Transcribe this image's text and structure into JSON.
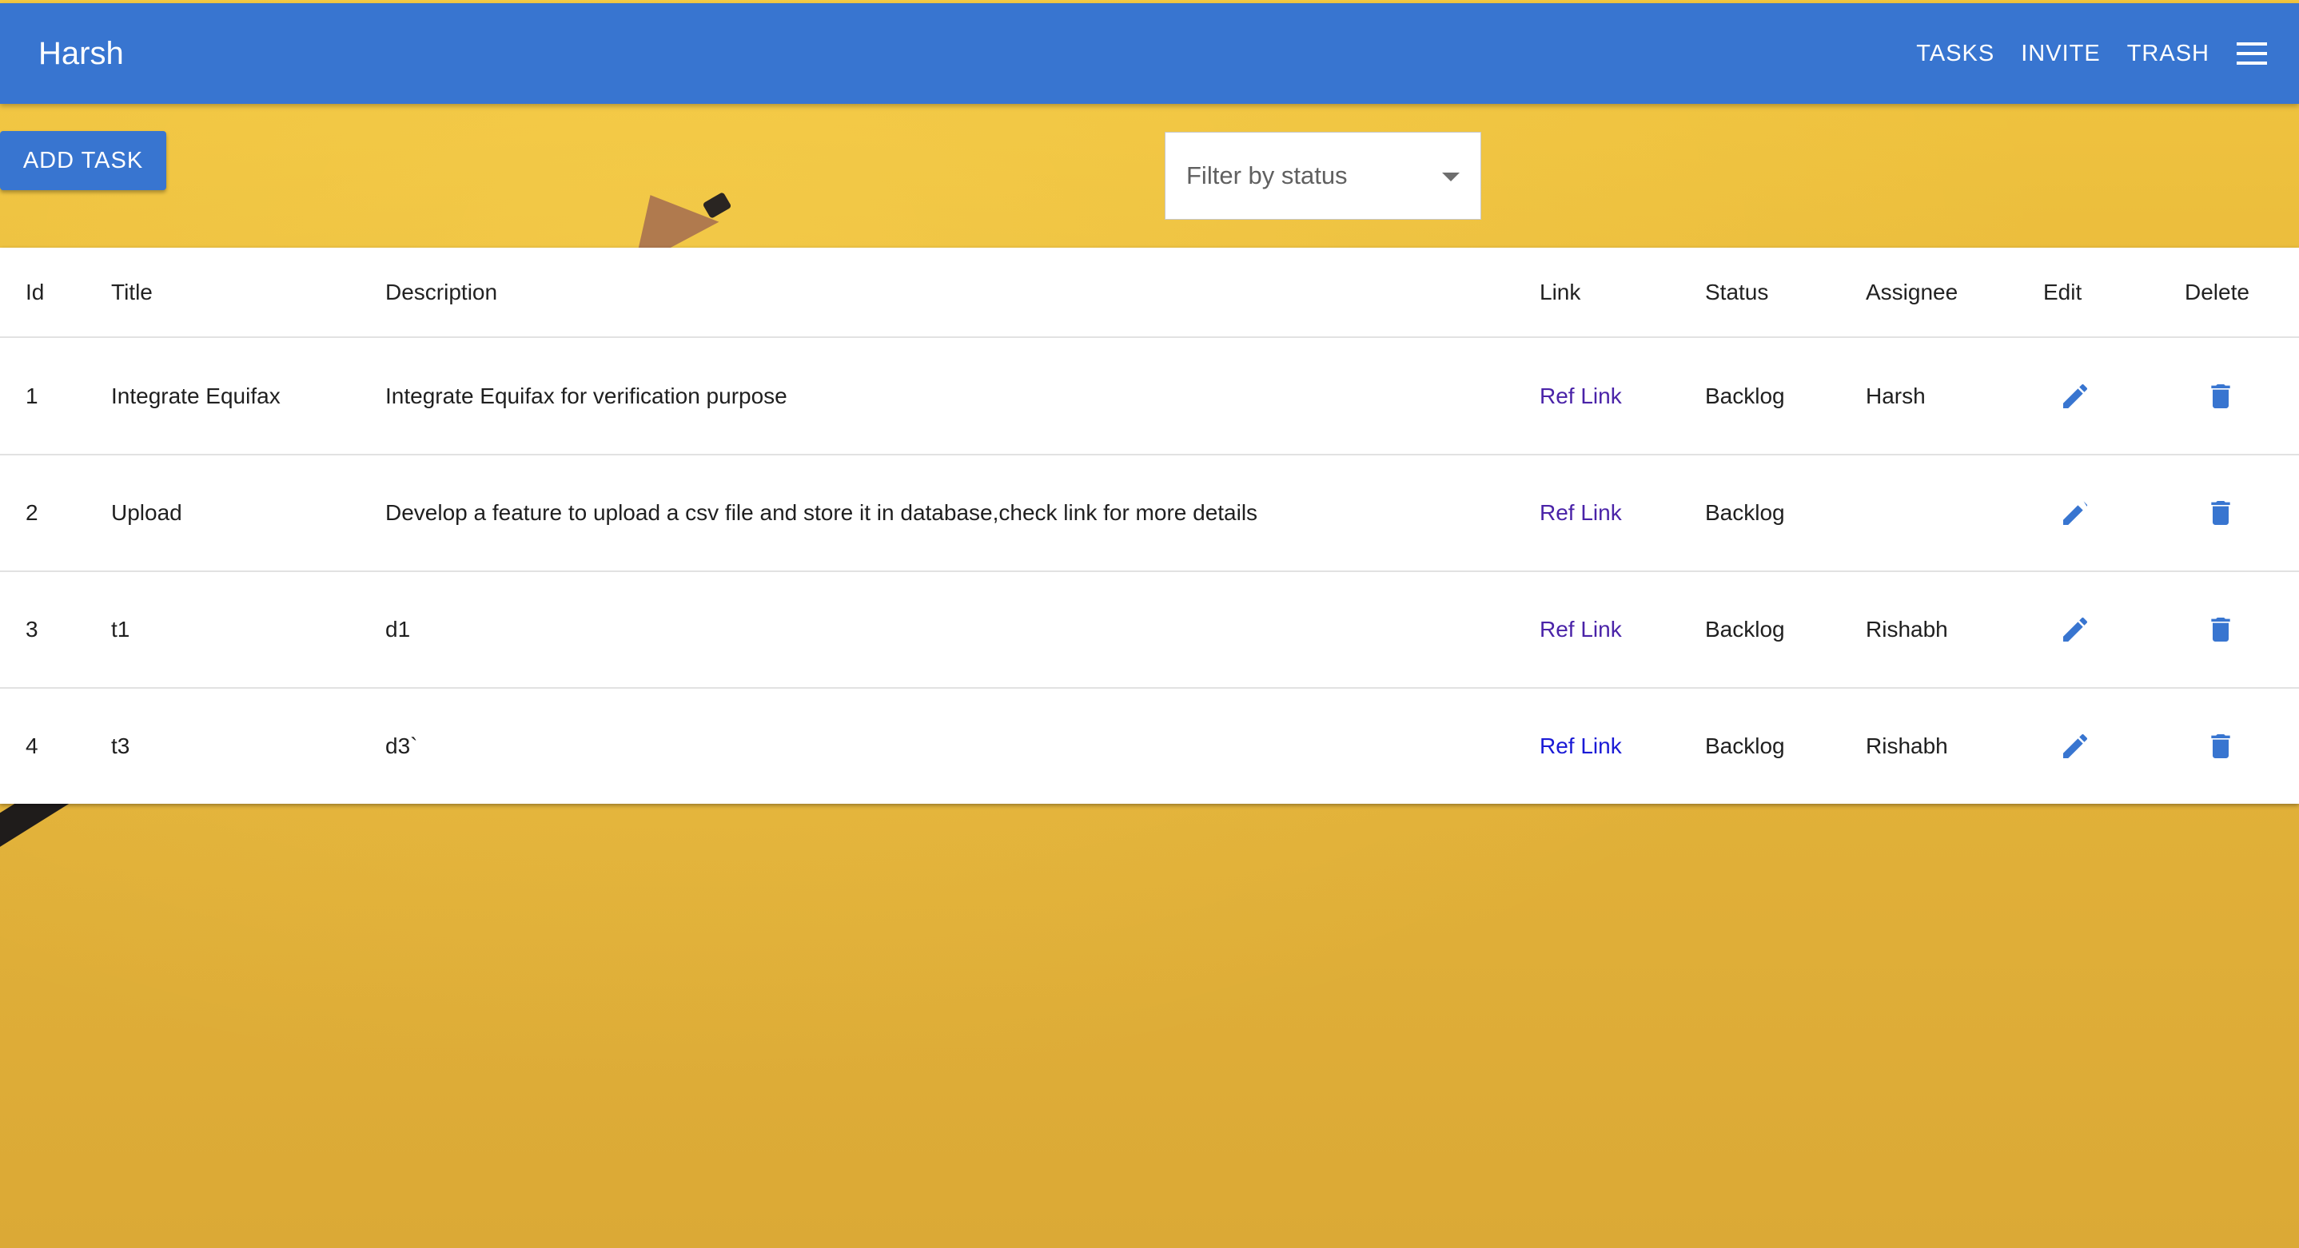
{
  "app": {
    "brand": "Harsh",
    "nav": [
      "TASKS",
      "INVITE",
      "TRASH"
    ],
    "menu_icon": "hamburger-menu-icon"
  },
  "toolbar": {
    "add_task_label": "ADD TASK",
    "filter_placeholder": "Filter by status"
  },
  "table": {
    "columns": [
      "Id",
      "Title",
      "Description",
      "Link",
      "Status",
      "Assignee",
      "Edit",
      "Delete"
    ],
    "rows": [
      {
        "id": "1",
        "title": "Integrate Equifax",
        "description": "Integrate Equifax for verification purpose",
        "link": "Ref Link",
        "status": "Backlog",
        "assignee": "Harsh"
      },
      {
        "id": "2",
        "title": "Upload",
        "description": "Develop a feature to upload a csv file and store it in database,check link for more details",
        "link": "Ref Link",
        "status": "Backlog",
        "assignee": ""
      },
      {
        "id": "3",
        "title": "t1",
        "description": "d1",
        "link": "Ref Link",
        "status": "Backlog",
        "assignee": "Rishabh"
      },
      {
        "id": "4",
        "title": "t3",
        "description": "d3`",
        "link": "Ref Link",
        "status": "Backlog",
        "assignee": "Rishabh"
      }
    ],
    "edit_icon": "pencil-icon",
    "delete_icon": "trash-icon"
  },
  "colors": {
    "primary": "#3875d0",
    "background": "#e9ba3a",
    "visited_link": "#4a23a8",
    "link": "#1a1ad6"
  }
}
